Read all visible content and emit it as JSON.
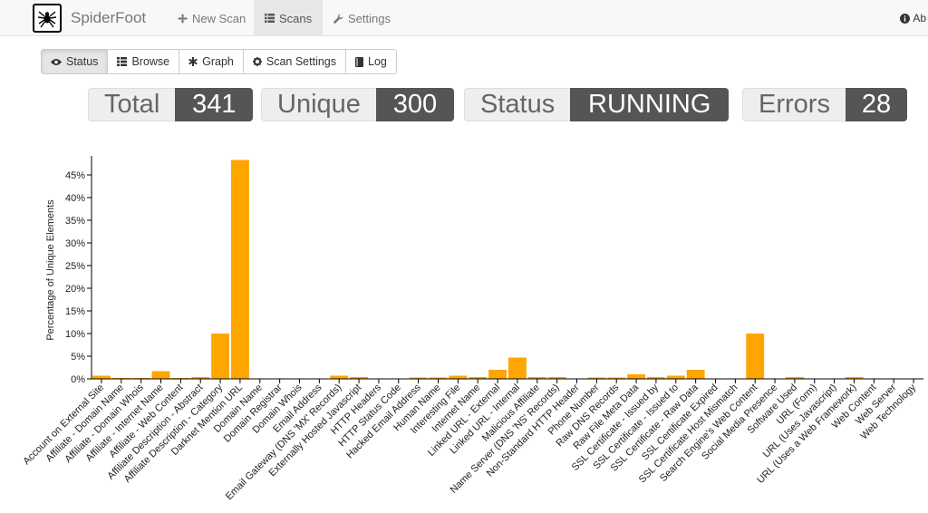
{
  "nav": {
    "brand": "SpiderFoot",
    "items": [
      {
        "label": "New Scan",
        "icon": "crosshairs-icon",
        "active": false
      },
      {
        "label": "Scans",
        "icon": "list-icon",
        "active": true
      },
      {
        "label": "Settings",
        "icon": "wrench-icon",
        "active": false
      }
    ],
    "about": "Ab"
  },
  "tabs": [
    {
      "label": "Status",
      "icon": "eye-icon",
      "active": true
    },
    {
      "label": "Browse",
      "icon": "table-icon",
      "active": false
    },
    {
      "label": "Graph",
      "icon": "asterisk-icon",
      "active": false
    },
    {
      "label": "Scan Settings",
      "icon": "cog-icon",
      "active": false
    },
    {
      "label": "Log",
      "icon": "book-icon",
      "active": false
    }
  ],
  "stats": {
    "total": {
      "label": "Total",
      "value": "341"
    },
    "unique": {
      "label": "Unique",
      "value": "300"
    },
    "status": {
      "label": "Status",
      "value": "RUNNING"
    },
    "errors": {
      "label": "Errors",
      "value": "28"
    }
  },
  "colors": {
    "bar": "#FFA500",
    "accent": "#555555"
  },
  "chart_data": {
    "type": "bar",
    "ylabel": "Percentage of Unique Elements",
    "ylim": [
      0,
      48
    ],
    "yticks": [
      "0%",
      "5%",
      "10%",
      "15%",
      "20%",
      "25%",
      "30%",
      "35%",
      "40%",
      "45%"
    ],
    "categories": [
      "Account on External Site",
      "Affiliate - Domain Name",
      "Affiliate - Domain Whois",
      "Affiliate - Internet Name",
      "Affiliate - Web Content",
      "Affiliate Description - Abstract",
      "Affiliate Description - Category",
      "Darknet Mention URL",
      "Domain Name",
      "Domain Registrar",
      "Domain Whois",
      "Email Address",
      "Email Gateway (DNS 'MX' Records)",
      "Externally Hosted Javascript",
      "HTTP Headers",
      "HTTP Status Code",
      "Hacked Email Address",
      "Human Name",
      "Interesting File",
      "Internet Name",
      "Linked URL - External",
      "Linked URL - Internal",
      "Malicious Affiliate",
      "Name Server (DNS 'NS' Records)",
      "Non-Standard HTTP Header",
      "Phone Number",
      "Raw DNS Records",
      "Raw File Meta Data",
      "SSL Certificate - Issued by",
      "SSL Certificate - Issued to",
      "SSL Certificate - Raw Data",
      "SSL Certificate Expired",
      "SSL Certificate Host Mismatch",
      "Search Engine's Web Content",
      "Social Media Presence",
      "Software Used",
      "URL (Form)",
      "URL (Uses Javascript)",
      "URL (Uses a Web Framework)",
      "Web Content",
      "Web Server",
      "Web Technology"
    ],
    "values": [
      0.7,
      0.2,
      0.2,
      1.7,
      0.2,
      0.4,
      10.0,
      48.3,
      0.1,
      0.1,
      0.1,
      0.1,
      0.7,
      0.4,
      0.1,
      0.1,
      0.3,
      0.3,
      0.7,
      0.4,
      2.0,
      4.7,
      0.4,
      0.4,
      0.1,
      0.3,
      0.3,
      1.0,
      0.4,
      0.7,
      2.0,
      0.1,
      0.1,
      10.0,
      0.1,
      0.4,
      0.1,
      0.1,
      0.4,
      0.1,
      0.1,
      0.1
    ]
  }
}
